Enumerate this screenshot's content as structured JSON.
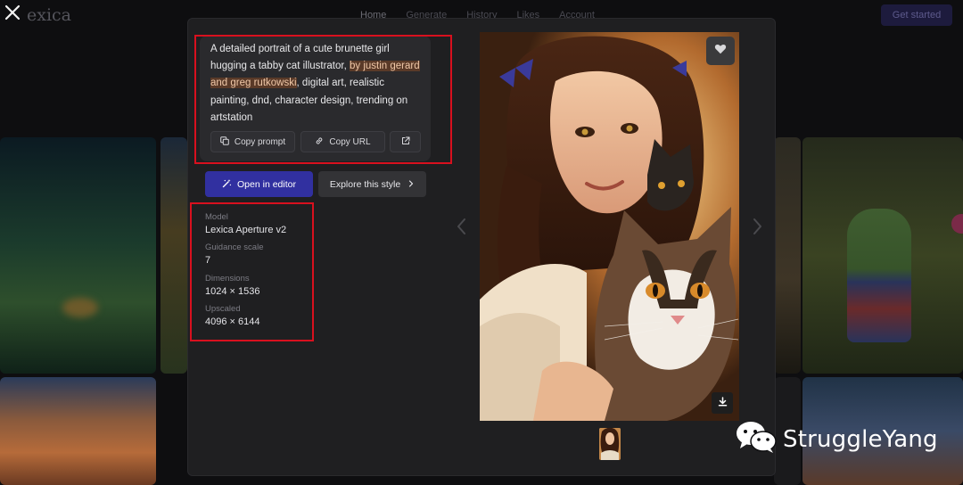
{
  "background": {
    "logo": "exica",
    "nav": [
      "Home",
      "Generate",
      "History",
      "Likes",
      "Account"
    ],
    "cta": "Get started"
  },
  "prompt": {
    "before": "A detailed portrait of a cute brunette girl hugging a tabby cat illustrator, ",
    "highlight": "by justin gerard and greg rutkowski",
    "after": ", digital art, realistic painting, dnd, character design, trending on artstation"
  },
  "buttons": {
    "copy_prompt": "Copy prompt",
    "copy_url": "Copy URL",
    "open_in_editor": "Open in editor",
    "explore_style": "Explore this style"
  },
  "details": [
    {
      "label": "Model",
      "value": "Lexica Aperture v2"
    },
    {
      "label": "Guidance scale",
      "value": "7"
    },
    {
      "label": "Dimensions",
      "value": "1024 × 1536"
    },
    {
      "label": "Upscaled",
      "value": "4096 × 6144"
    }
  ],
  "watermark": "StruggleYang",
  "colors": {
    "primary_button": "#3130a0",
    "annotation_box": "#d8101e",
    "prompt_highlight": "#5a3a28"
  },
  "icons": [
    "close-icon",
    "copy-icon",
    "link-icon",
    "external-link-icon",
    "magic-wand-icon",
    "chevron-right-icon",
    "chevron-left-icon",
    "heart-icon",
    "download-icon",
    "wechat-icon"
  ]
}
